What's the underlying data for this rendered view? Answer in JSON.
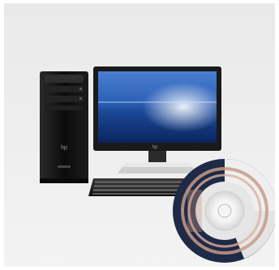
{
  "scene": {
    "description_alt": "",
    "colors": {
      "backdrop": "#ececec",
      "tower": "#151515",
      "monitor_bezel": "#1a1a1a",
      "screen_sky": "#2a5fb4",
      "screen_sea": "#0f2b66",
      "disc_accent": "#c99a86",
      "disc_dark": "#1f2a47"
    },
    "icons": [
      "desktop-computer",
      "monitor",
      "keyboard",
      "software-disc"
    ]
  }
}
